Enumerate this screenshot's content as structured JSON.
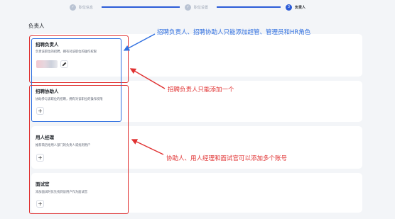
{
  "stepper": {
    "steps": [
      {
        "number": "✓",
        "label": "职位信息",
        "state": "done"
      },
      {
        "number": "✓",
        "label": "职位设置",
        "state": "done"
      },
      {
        "number": "3",
        "label": "负责人",
        "state": "active"
      }
    ]
  },
  "section": {
    "title": "负责人"
  },
  "cards": {
    "recruiter": {
      "title": "招聘负责人",
      "desc": "负责该职位的招聘，拥有对该职位的操作权限"
    },
    "assistant": {
      "title": "招聘协助人",
      "desc": "协助参与该职位的招聘，拥有对该职位的操作权限"
    },
    "hiring_manager": {
      "title": "用人经理",
      "desc": "推荐简历给用人部门的负责人或找到用户"
    },
    "interviewer": {
      "title": "面试官",
      "desc": "添加面试时优先找到该用户作为面试官"
    }
  },
  "buttons": {
    "add_label": "+"
  },
  "annotations": {
    "note_roles": "招聘负责人、招聘协助人只能添加超管、管理员和HR角色",
    "note_single": "招聘负责人只能添加一个",
    "note_multi": "协助人、用人经理和面试官可以添加多个账号"
  },
  "colors": {
    "accent": "#2b5bd7",
    "annotation_red": "#e03131",
    "annotation_blue": "#2f6fe0",
    "background": "#f3f5f8"
  }
}
